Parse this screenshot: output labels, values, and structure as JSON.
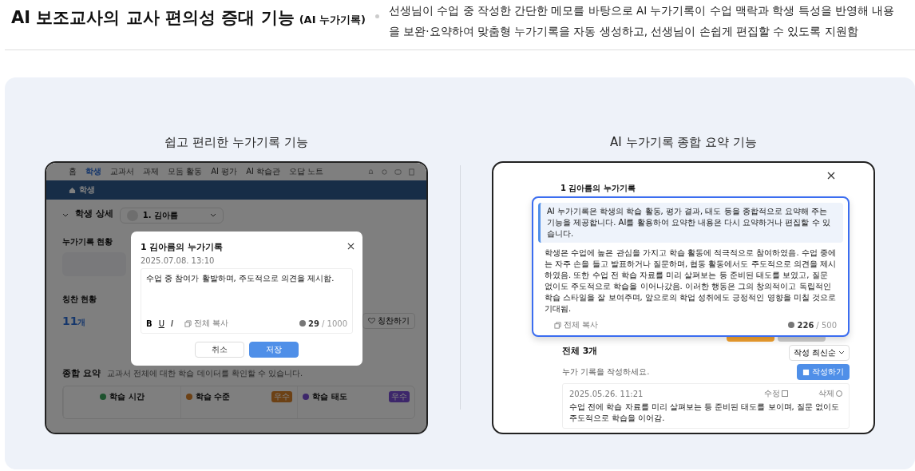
{
  "header": {
    "title": "AI 보조교사의 교사 편의성 증대 기능",
    "subtitle": "(AI 누가기록)",
    "description": "선생님이 수업 중 작성한 간단한 메모를 바탕으로 AI 누가기록이 수업 맥락과 학생 특성을 반영해 내용을 보완·요약하여 맞춤형 누가기록을 자동 생성하고, 선생님이 손쉽게 편집할 수 있도록 지원함"
  },
  "left_feature": {
    "heading": "쉽고 편리한 누가기록 기능",
    "app": {
      "nav": [
        {
          "label": "홈",
          "selected": false
        },
        {
          "label": "학생",
          "selected": true
        },
        {
          "label": "교과서",
          "selected": false
        },
        {
          "label": "과제",
          "selected": false
        },
        {
          "label": "모둠 활동",
          "selected": false
        },
        {
          "label": "AI 평가",
          "selected": false
        },
        {
          "label": "AI 학습관",
          "selected": false
        },
        {
          "label": "오답 노트",
          "selected": false
        }
      ],
      "breadcrumb": "학생",
      "page_title": "학생 상세",
      "student": "1. 김아름",
      "record_section": "누가기록 현황",
      "praise_section": "칭찬 현황",
      "praise_count": "11",
      "praise_unit": "개",
      "praise_button": "칭찬하기",
      "summary": {
        "title": "종합 요약",
        "description": "교과서 전체에 대한 학습 데이터를 확인할 수 있습니다.",
        "cards": [
          {
            "title": "학습 시간",
            "kind": "time"
          },
          {
            "title": "학습 수준",
            "badge": "우수",
            "kind": "level"
          },
          {
            "title": "학습 태도",
            "badge": "우수",
            "kind": "attitude"
          }
        ]
      }
    },
    "modal": {
      "title": "1 김아름의 누가기록",
      "date": "2025.07.08. 13:10",
      "text": "수업 중 참여가 활발하며, 주도적으로 의견을 제시함.",
      "format_buttons": [
        {
          "label": "B",
          "kind": "bold"
        },
        {
          "label": "U",
          "kind": "underline"
        },
        {
          "label": "I",
          "kind": "italic"
        }
      ],
      "copy": "전체 복사",
      "count": "29",
      "limit": "/ 1000",
      "cancel": "취소",
      "save": "저장"
    }
  },
  "right_feature": {
    "heading": "AI 누가기록 종합 요약 기능",
    "title": "1 김아름의 누가기록",
    "notice": "AI 누가기록은 학생의 학습 활동, 평가 결과, 태도 등을 종합적으로 요약해 주는 기능을 제공합니다. AI를 활용하여 요약한 내용은 다시 요약하거나 편집할 수 있습니다.",
    "summary": "학생은 수업에 높은 관심을 가지고 학습 활동에 적극적으로 참여하였음. 수업 중에는 자주 손을 들고 발표하거나 질문하며, 협동 활동에서도 주도적으로 의견을 제시하였음. 또한 수업 전 학습 자료를 미리 살펴보는 등 준비된 태도를 보였고, 질문 없이도 주도적으로 학습을 이어나갔음. 이러한 행동은 그의 창의적이고 독립적인 학습 스타일을 잘 보여주며, 앞으로의 학업 성취에도 긍정적인 영향을 미칠 것으로 기대됨.",
    "copy": "전체 복사",
    "count": "226",
    "limit": "/ 500",
    "list": {
      "total": "전체 3개",
      "sort": "작성 최신순",
      "hint": "누가 기록을 작성하세요.",
      "write": "작성하기",
      "records": [
        {
          "date": "2025.05.26. 11:21",
          "edit": "수정",
          "delete": "삭제",
          "text": "수업 전에 학습 자료를 미리 살펴보는 등 준비된 태도를 보이며, 질문 없이도 주도적으로 학습을 이어감."
        }
      ]
    }
  }
}
